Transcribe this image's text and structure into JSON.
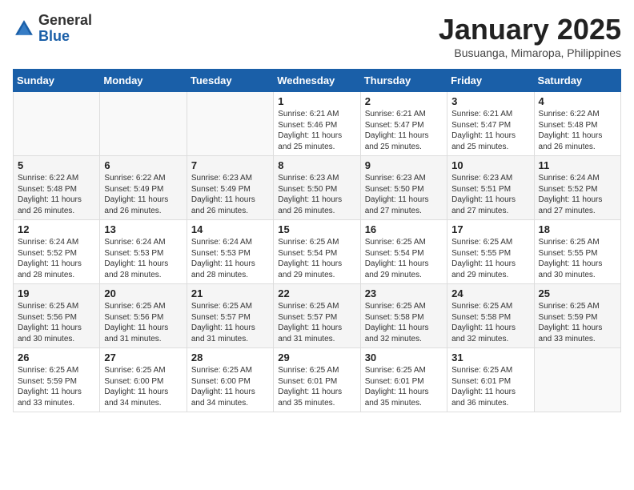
{
  "header": {
    "logo_general": "General",
    "logo_blue": "Blue",
    "month_title": "January 2025",
    "location": "Busuanga, Mimaropa, Philippines"
  },
  "weekdays": [
    "Sunday",
    "Monday",
    "Tuesday",
    "Wednesday",
    "Thursday",
    "Friday",
    "Saturday"
  ],
  "weeks": [
    [
      {
        "day": "",
        "info": ""
      },
      {
        "day": "",
        "info": ""
      },
      {
        "day": "",
        "info": ""
      },
      {
        "day": "1",
        "info": "Sunrise: 6:21 AM\nSunset: 5:46 PM\nDaylight: 11 hours\nand 25 minutes."
      },
      {
        "day": "2",
        "info": "Sunrise: 6:21 AM\nSunset: 5:47 PM\nDaylight: 11 hours\nand 25 minutes."
      },
      {
        "day": "3",
        "info": "Sunrise: 6:21 AM\nSunset: 5:47 PM\nDaylight: 11 hours\nand 25 minutes."
      },
      {
        "day": "4",
        "info": "Sunrise: 6:22 AM\nSunset: 5:48 PM\nDaylight: 11 hours\nand 26 minutes."
      }
    ],
    [
      {
        "day": "5",
        "info": "Sunrise: 6:22 AM\nSunset: 5:48 PM\nDaylight: 11 hours\nand 26 minutes."
      },
      {
        "day": "6",
        "info": "Sunrise: 6:22 AM\nSunset: 5:49 PM\nDaylight: 11 hours\nand 26 minutes."
      },
      {
        "day": "7",
        "info": "Sunrise: 6:23 AM\nSunset: 5:49 PM\nDaylight: 11 hours\nand 26 minutes."
      },
      {
        "day": "8",
        "info": "Sunrise: 6:23 AM\nSunset: 5:50 PM\nDaylight: 11 hours\nand 26 minutes."
      },
      {
        "day": "9",
        "info": "Sunrise: 6:23 AM\nSunset: 5:50 PM\nDaylight: 11 hours\nand 27 minutes."
      },
      {
        "day": "10",
        "info": "Sunrise: 6:23 AM\nSunset: 5:51 PM\nDaylight: 11 hours\nand 27 minutes."
      },
      {
        "day": "11",
        "info": "Sunrise: 6:24 AM\nSunset: 5:52 PM\nDaylight: 11 hours\nand 27 minutes."
      }
    ],
    [
      {
        "day": "12",
        "info": "Sunrise: 6:24 AM\nSunset: 5:52 PM\nDaylight: 11 hours\nand 28 minutes."
      },
      {
        "day": "13",
        "info": "Sunrise: 6:24 AM\nSunset: 5:53 PM\nDaylight: 11 hours\nand 28 minutes."
      },
      {
        "day": "14",
        "info": "Sunrise: 6:24 AM\nSunset: 5:53 PM\nDaylight: 11 hours\nand 28 minutes."
      },
      {
        "day": "15",
        "info": "Sunrise: 6:25 AM\nSunset: 5:54 PM\nDaylight: 11 hours\nand 29 minutes."
      },
      {
        "day": "16",
        "info": "Sunrise: 6:25 AM\nSunset: 5:54 PM\nDaylight: 11 hours\nand 29 minutes."
      },
      {
        "day": "17",
        "info": "Sunrise: 6:25 AM\nSunset: 5:55 PM\nDaylight: 11 hours\nand 29 minutes."
      },
      {
        "day": "18",
        "info": "Sunrise: 6:25 AM\nSunset: 5:55 PM\nDaylight: 11 hours\nand 30 minutes."
      }
    ],
    [
      {
        "day": "19",
        "info": "Sunrise: 6:25 AM\nSunset: 5:56 PM\nDaylight: 11 hours\nand 30 minutes."
      },
      {
        "day": "20",
        "info": "Sunrise: 6:25 AM\nSunset: 5:56 PM\nDaylight: 11 hours\nand 31 minutes."
      },
      {
        "day": "21",
        "info": "Sunrise: 6:25 AM\nSunset: 5:57 PM\nDaylight: 11 hours\nand 31 minutes."
      },
      {
        "day": "22",
        "info": "Sunrise: 6:25 AM\nSunset: 5:57 PM\nDaylight: 11 hours\nand 31 minutes."
      },
      {
        "day": "23",
        "info": "Sunrise: 6:25 AM\nSunset: 5:58 PM\nDaylight: 11 hours\nand 32 minutes."
      },
      {
        "day": "24",
        "info": "Sunrise: 6:25 AM\nSunset: 5:58 PM\nDaylight: 11 hours\nand 32 minutes."
      },
      {
        "day": "25",
        "info": "Sunrise: 6:25 AM\nSunset: 5:59 PM\nDaylight: 11 hours\nand 33 minutes."
      }
    ],
    [
      {
        "day": "26",
        "info": "Sunrise: 6:25 AM\nSunset: 5:59 PM\nDaylight: 11 hours\nand 33 minutes."
      },
      {
        "day": "27",
        "info": "Sunrise: 6:25 AM\nSunset: 6:00 PM\nDaylight: 11 hours\nand 34 minutes."
      },
      {
        "day": "28",
        "info": "Sunrise: 6:25 AM\nSunset: 6:00 PM\nDaylight: 11 hours\nand 34 minutes."
      },
      {
        "day": "29",
        "info": "Sunrise: 6:25 AM\nSunset: 6:01 PM\nDaylight: 11 hours\nand 35 minutes."
      },
      {
        "day": "30",
        "info": "Sunrise: 6:25 AM\nSunset: 6:01 PM\nDaylight: 11 hours\nand 35 minutes."
      },
      {
        "day": "31",
        "info": "Sunrise: 6:25 AM\nSunset: 6:01 PM\nDaylight: 11 hours\nand 36 minutes."
      },
      {
        "day": "",
        "info": ""
      }
    ]
  ]
}
